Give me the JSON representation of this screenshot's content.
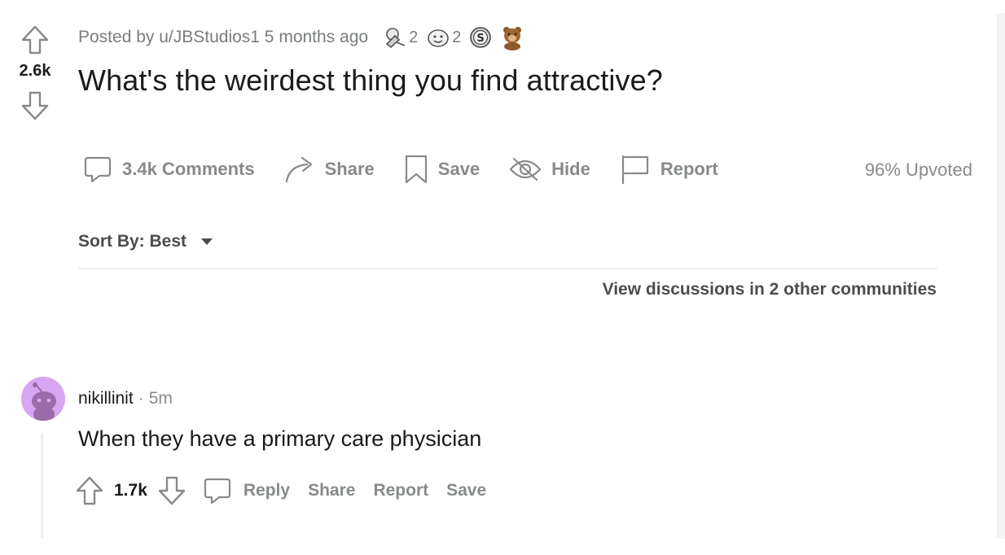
{
  "post": {
    "score": "2.6k",
    "meta_text": "Posted by u/JBStudios1 5 months ago",
    "awards": [
      {
        "icon": "helpful-award-icon",
        "count": "2"
      },
      {
        "icon": "wholesome-award-icon",
        "count": "2"
      },
      {
        "icon": "silver-award-icon",
        "count": ""
      },
      {
        "icon": "bear-award-icon",
        "count": ""
      }
    ],
    "title": "What's the weirdest thing you find attractive?",
    "actions": {
      "comments": "3.4k Comments",
      "share": "Share",
      "save": "Save",
      "hide": "Hide",
      "report": "Report"
    },
    "upvoted": "96% Upvoted"
  },
  "sort": {
    "label": "Sort By: Best"
  },
  "other_communities": "View discussions in 2 other communities",
  "comment": {
    "username": "nikillinit",
    "separator": "·",
    "time": "5m",
    "body": "When they have a primary care physician",
    "score": "1.7k",
    "reply": "Reply",
    "share": "Share",
    "report": "Report",
    "save": "Save"
  },
  "colors": {
    "muted": "#878a8c",
    "text": "#1a1a1b",
    "avatar_bg": "#d7a5f1"
  }
}
